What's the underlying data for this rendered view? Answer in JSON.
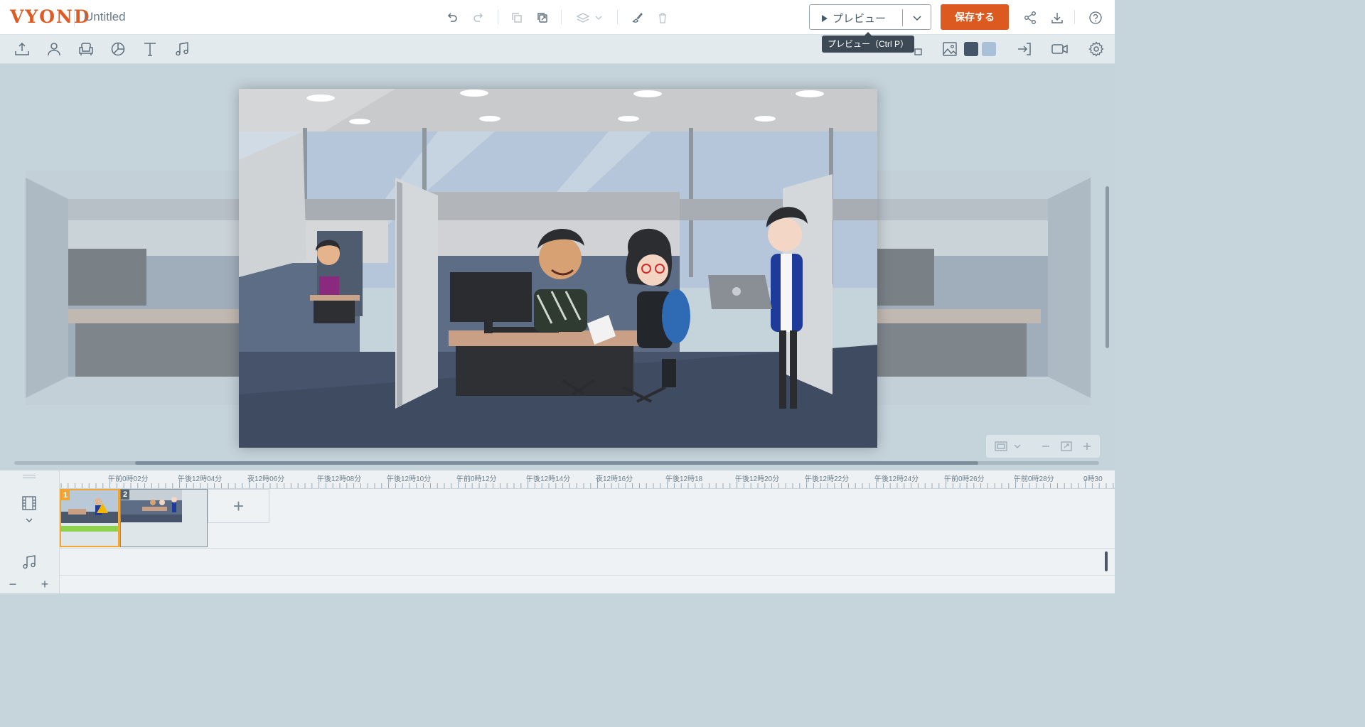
{
  "app": {
    "logo_text": "VYOND",
    "doc_title": "Untitled"
  },
  "header": {
    "preview_label": "プレビュー",
    "save_label": "保存する",
    "tooltip": "プレビュー（Ctrl P）"
  },
  "icons": {
    "top": [
      "undo-icon",
      "redo-icon",
      "copy-icon",
      "duplicate-icon",
      "layers-icon",
      "paint-icon",
      "trash-icon",
      "share-icon",
      "download-icon",
      "help-icon"
    ],
    "library": [
      "upload-icon",
      "character-icon",
      "prop-icon",
      "chart-icon",
      "text-icon",
      "music-icon"
    ],
    "right": [
      "image-icon",
      "exit-icon",
      "camera-icon",
      "settings-icon"
    ]
  },
  "colors": {
    "accent": "#dc5a20",
    "swatch_dark": "#44556a",
    "swatch_light": "#a9c0d8"
  },
  "timeline": {
    "ruler_labels": [
      "午前0時02分",
      "午後12時04分",
      "夜12時06分",
      "午後12時08分",
      "午後12時10分",
      "午前0時12分",
      "午後12時14分",
      "夜12時16分",
      "午後12時18",
      "午後12時20分",
      "午後12時22分",
      "午後12時24分",
      "午前0時26分",
      "午前0時28分",
      "0時30"
    ],
    "scenes": [
      {
        "number": "1"
      },
      {
        "number": "2"
      }
    ],
    "add_scene_label": "+",
    "zoom_out_label": "−",
    "zoom_in_label": "+"
  }
}
